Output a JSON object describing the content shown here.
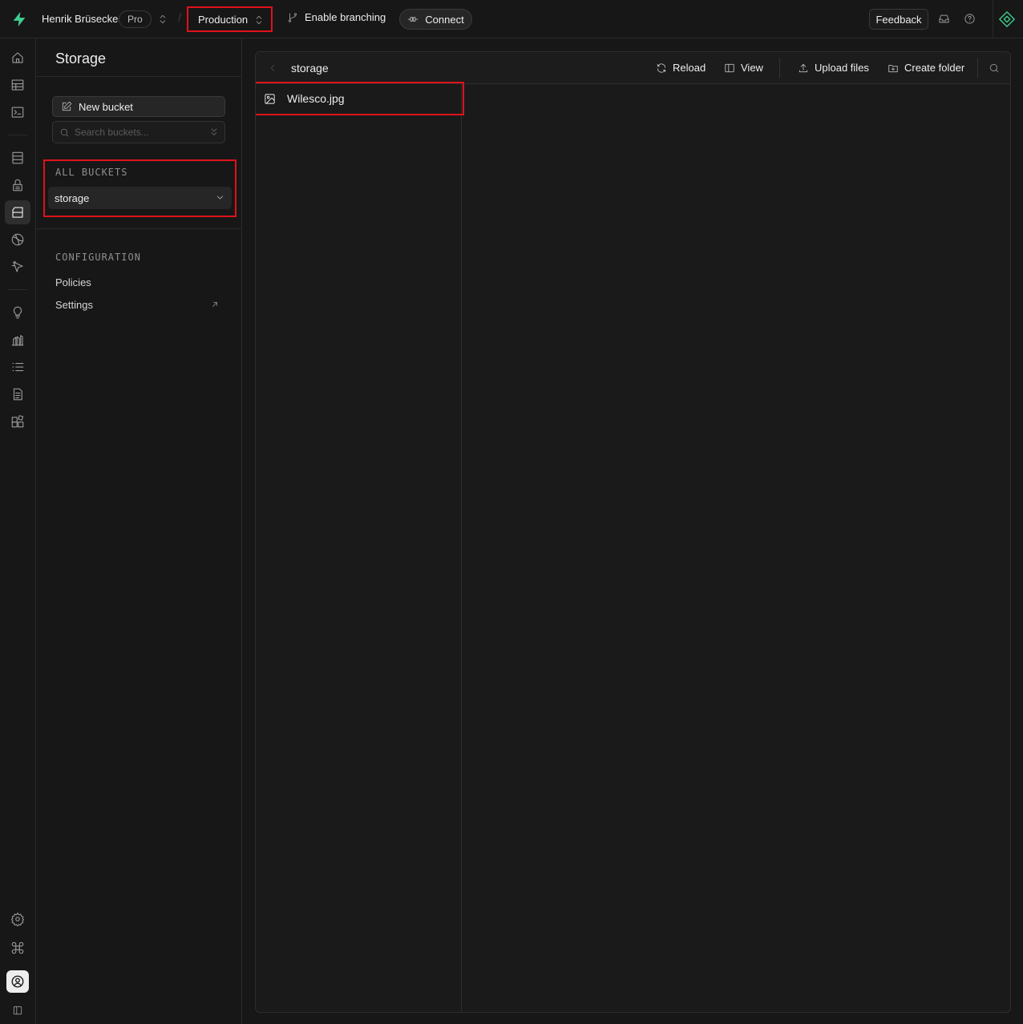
{
  "topbar": {
    "org_name": "Henrik Brüsecke",
    "plan": "Pro",
    "project": "Production",
    "branching_label": "Enable branching",
    "connect_label": "Connect",
    "feedback_label": "Feedback"
  },
  "colors": {
    "brand": "#3ecf8e",
    "background": "#171717",
    "highlight": "#e0121a"
  },
  "rail": {
    "icons": [
      "home-icon",
      "table-editor-icon",
      "sql-editor-icon",
      "database-icon",
      "auth-icon",
      "storage-icon",
      "edge-functions-icon",
      "realtime-icon",
      "advisors-icon",
      "reports-icon",
      "logs-icon",
      "api-docs-icon",
      "integrations-icon",
      "settings-icon",
      "command-icon",
      "avatar-icon",
      "collapse-icon"
    ],
    "active": "storage-icon"
  },
  "sidebar": {
    "title": "Storage",
    "new_bucket_label": "New bucket",
    "search_placeholder": "Search buckets...",
    "all_buckets_label": "ALL BUCKETS",
    "buckets": [
      {
        "name": "storage"
      }
    ],
    "configuration_label": "CONFIGURATION",
    "config_links": [
      {
        "label": "Policies"
      },
      {
        "label": "Settings"
      }
    ]
  },
  "explorer": {
    "breadcrumb": "storage",
    "toolbar": {
      "reload": "Reload",
      "view": "View",
      "upload": "Upload files",
      "create_folder": "Create folder"
    },
    "files": [
      {
        "name": "Wilesco.jpg",
        "type": "image"
      }
    ]
  }
}
